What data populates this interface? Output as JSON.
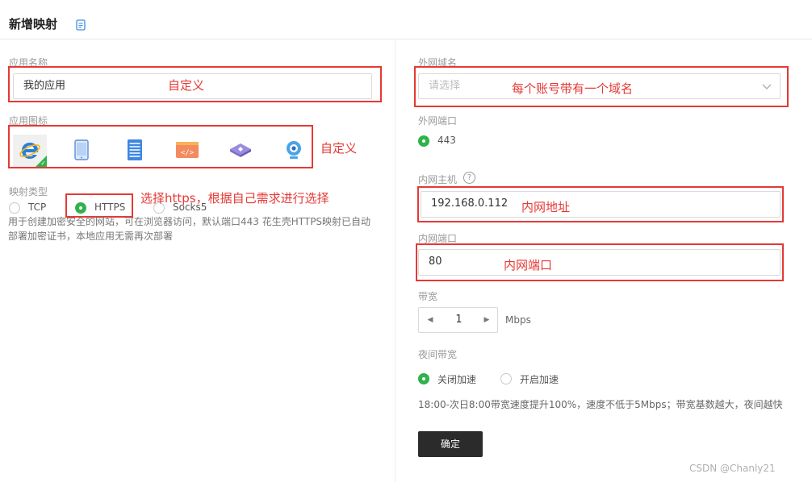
{
  "header": {
    "title": "新增映射",
    "doc_icon": "document-icon"
  },
  "left": {
    "app_name": {
      "label": "应用名称",
      "value": "我的应用"
    },
    "app_icon": {
      "label": "应用图标",
      "icons": [
        "ie-browser-icon",
        "tablet-icon",
        "server-icon",
        "code-window-icon",
        "network-device-icon",
        "webcam-icon"
      ],
      "selected_index": 0
    },
    "mapping_type": {
      "label": "映射类型",
      "options": [
        "TCP",
        "HTTPS",
        "Socks5"
      ],
      "selected": "HTTPS",
      "description_line1": "用于创建加密安全的网站，可在浏览器访问，默认端口443 花生壳HTTPS映射已自动",
      "description_line2": "部署加密证书，本地应用无需再次部署"
    }
  },
  "right": {
    "external_domain": {
      "label": "外网域名",
      "placeholder": "请选择"
    },
    "external_port": {
      "label": "外网端口",
      "value": "443"
    },
    "internal_host": {
      "label": "内网主机",
      "help": "?",
      "value": "192.168.0.112"
    },
    "internal_port": {
      "label": "内网端口",
      "value": "80"
    },
    "bandwidth": {
      "label": "带宽",
      "value": "1",
      "unit": "Mbps",
      "dec": "◀",
      "inc": "▶"
    },
    "night_bandwidth": {
      "label": "夜间带宽",
      "options": [
        "关闭加速",
        "开启加速"
      ],
      "selected": "关闭加速",
      "note": "18:00-次日8:00带宽速度提升100%，速度不低于5Mbps；带宽基数越大，夜间越快"
    },
    "confirm_label": "确定"
  },
  "annotations": {
    "app_name": "自定义",
    "domain": "每个账号带有一个域名",
    "icon": "自定义",
    "https": "选择https，根据自己需求进行选择",
    "host": "内网地址",
    "port": "内网端口"
  },
  "watermark": "CSDN @Chanly21",
  "colors": {
    "accent_green": "#2fb34a",
    "annotation_red": "#e53935",
    "button_dark": "#2b2b2b"
  }
}
